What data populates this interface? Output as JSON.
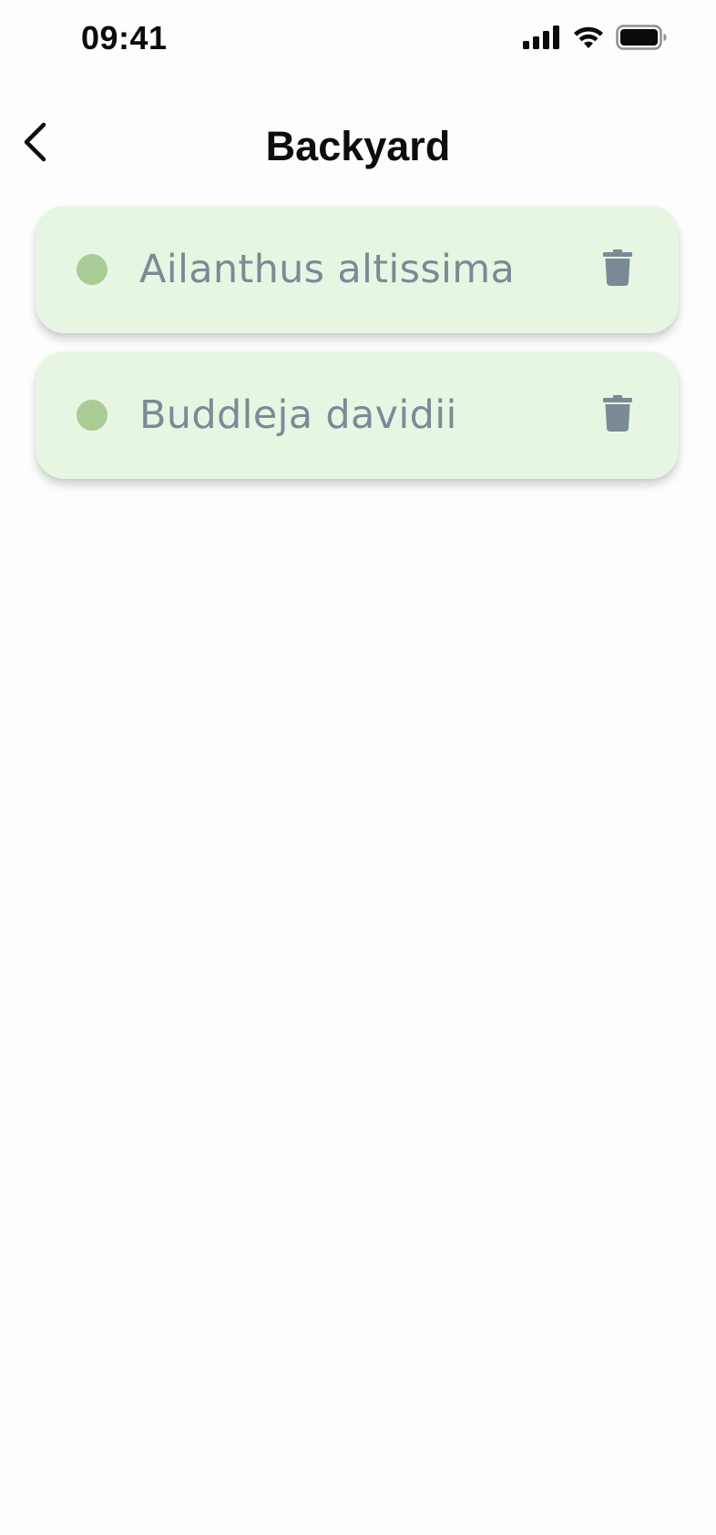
{
  "status_bar": {
    "time": "09:41",
    "icons": [
      "cellular-signal-icon",
      "wifi-icon",
      "battery-icon"
    ]
  },
  "header": {
    "title": "Backyard",
    "back_icon": "chevron-left-icon"
  },
  "plants": [
    {
      "name": "Ailanthus altissima",
      "status_color": "#a8cc94",
      "delete_icon": "trash-icon"
    },
    {
      "name": "Buddleja davidii",
      "status_color": "#a8cc94",
      "delete_icon": "trash-icon"
    }
  ],
  "colors": {
    "card_background": "#e7f6e3",
    "text_secondary": "#7a8b96",
    "icon_gray": "#7a8b96",
    "status_dot": "#a8cc94"
  }
}
